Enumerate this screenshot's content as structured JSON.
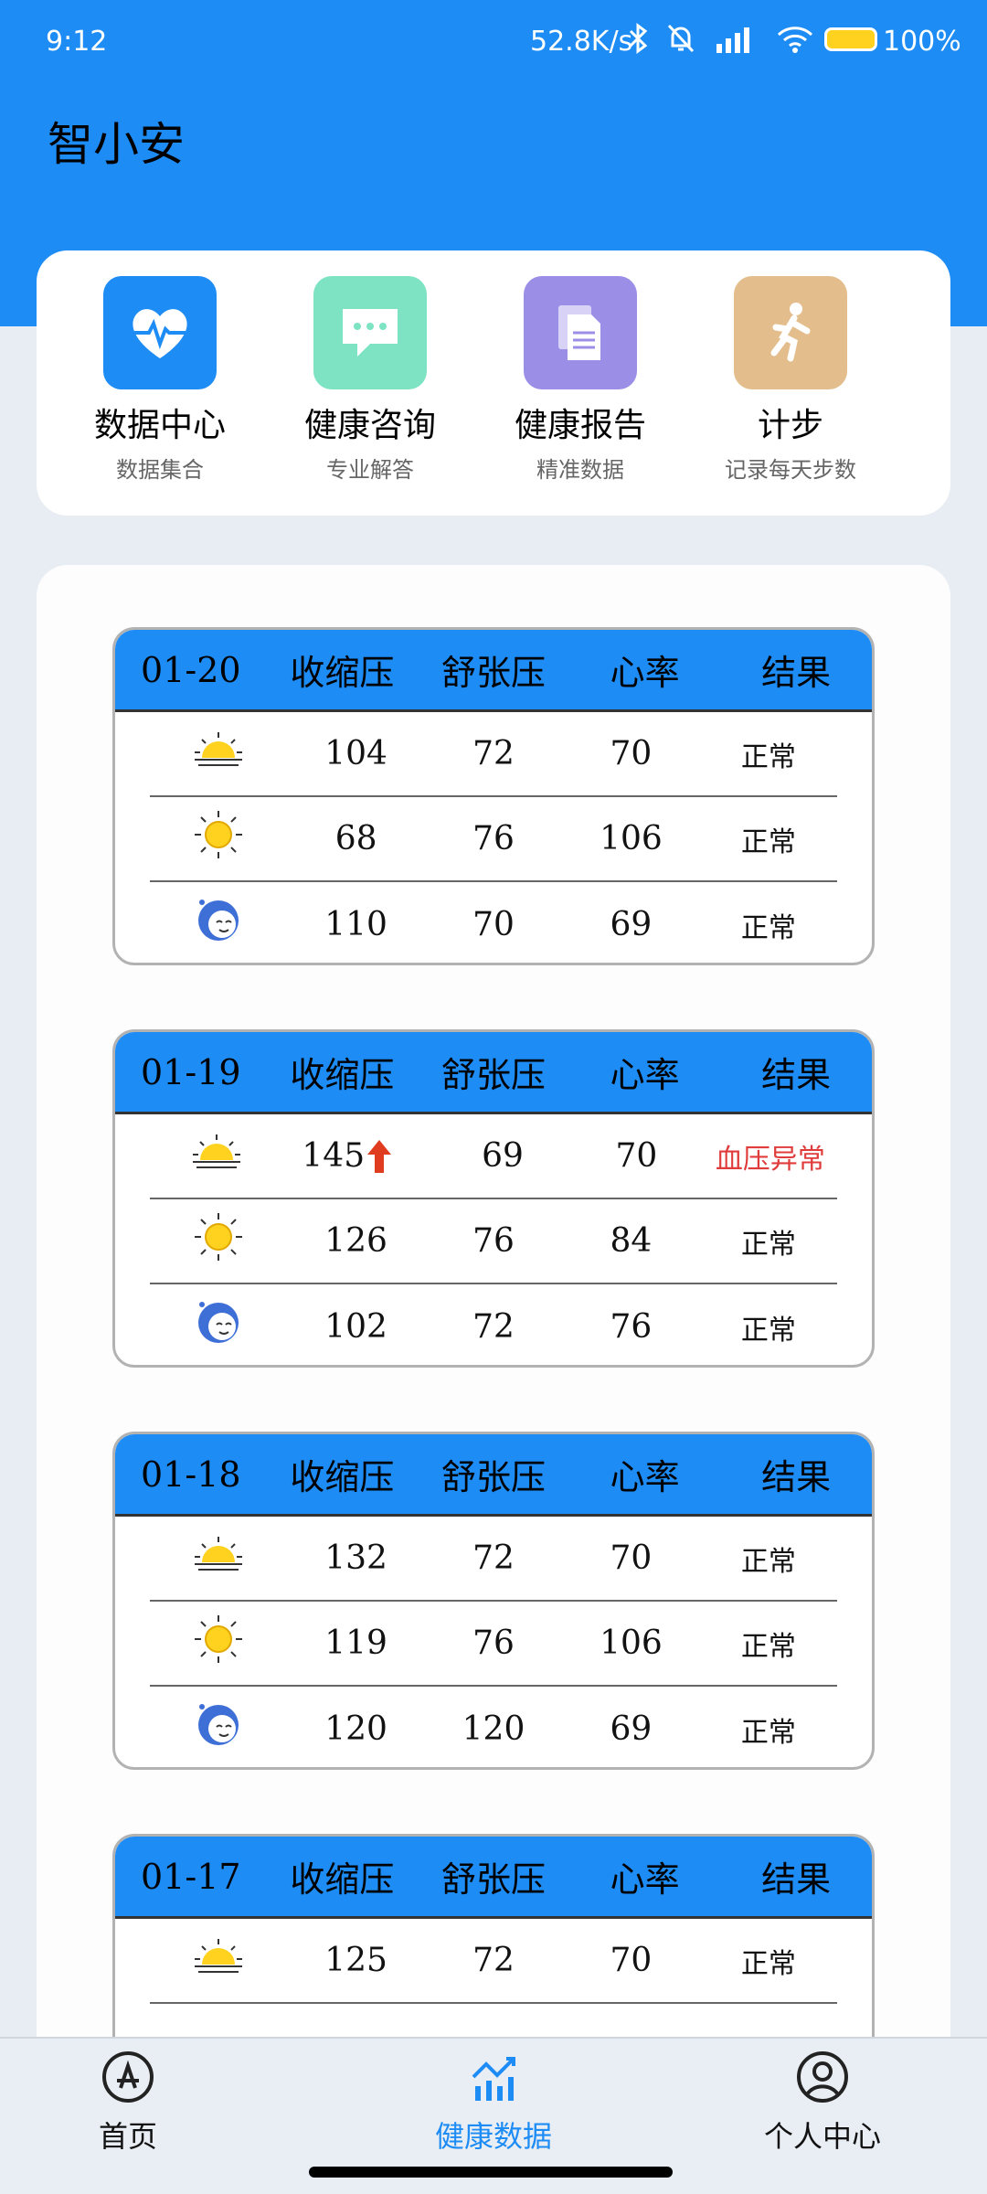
{
  "status": {
    "time": "9:12",
    "net_speed": "52.8K/s",
    "battery": "100%"
  },
  "app": {
    "title": "智小安"
  },
  "quick_links": [
    {
      "label": "数据中心",
      "sub": "数据集合",
      "color": "#1e8cf5",
      "icon": "heart-pulse-icon"
    },
    {
      "label": "健康咨询",
      "sub": "专业解答",
      "color": "#7de3c3",
      "icon": "chat-bubble-icon"
    },
    {
      "label": "健康报告",
      "sub": "精准数据",
      "color": "#9b8ee6",
      "icon": "document-icon"
    },
    {
      "label": "计步",
      "sub": "记录每天步数",
      "color": "#e3bd8b",
      "icon": "running-person-icon"
    }
  ],
  "table_headers": {
    "sys": "收缩压",
    "dia": "舒张压",
    "hr": "心率",
    "result": "结果"
  },
  "days": [
    {
      "date": "01-20",
      "rows": [
        {
          "period": "morning",
          "sys": "104",
          "dia": "72",
          "hr": "70",
          "result": "正常",
          "abnormal": false
        },
        {
          "period": "noon",
          "sys": "68",
          "dia": "76",
          "hr": "106",
          "result": "正常",
          "abnormal": false
        },
        {
          "period": "night",
          "sys": "110",
          "dia": "70",
          "hr": "69",
          "result": "正常",
          "abnormal": false
        }
      ]
    },
    {
      "date": "01-19",
      "rows": [
        {
          "period": "morning",
          "sys": "145",
          "dia": "69",
          "hr": "70",
          "result": "血压异常",
          "abnormal": true
        },
        {
          "period": "noon",
          "sys": "126",
          "dia": "76",
          "hr": "84",
          "result": "正常",
          "abnormal": false
        },
        {
          "period": "night",
          "sys": "102",
          "dia": "72",
          "hr": "76",
          "result": "正常",
          "abnormal": false
        }
      ]
    },
    {
      "date": "01-18",
      "rows": [
        {
          "period": "morning",
          "sys": "132",
          "dia": "72",
          "hr": "70",
          "result": "正常",
          "abnormal": false
        },
        {
          "period": "noon",
          "sys": "119",
          "dia": "76",
          "hr": "106",
          "result": "正常",
          "abnormal": false
        },
        {
          "period": "night",
          "sys": "120",
          "dia": "120",
          "hr": "69",
          "result": "正常",
          "abnormal": false
        }
      ]
    },
    {
      "date": "01-17",
      "rows": [
        {
          "period": "morning",
          "sys": "125",
          "dia": "72",
          "hr": "70",
          "result": "正常",
          "abnormal": false
        }
      ]
    }
  ],
  "nav": [
    {
      "label": "首页",
      "icon": "app-store-icon",
      "active": false
    },
    {
      "label": "健康数据",
      "icon": "chart-icon",
      "active": true
    },
    {
      "label": "个人中心",
      "icon": "user-icon",
      "active": false
    }
  ],
  "colors": {
    "primary": "#1e8cf5",
    "abnormal": "#e03c3c"
  }
}
